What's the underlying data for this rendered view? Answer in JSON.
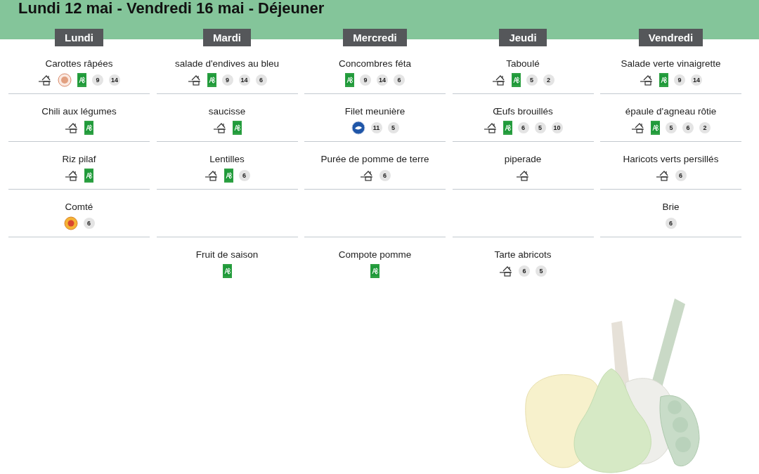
{
  "header": {
    "title": "Lundi 12 mai - Vendredi 16 mai  - Déjeuner"
  },
  "days": [
    {
      "label": "Lundi",
      "courses": [
        {
          "kind": "dish",
          "name": "Carottes râpées",
          "labels": [
            {
              "kind": "homemade"
            },
            {
              "kind": "seal"
            },
            {
              "kind": "organic"
            }
          ],
          "allergens": [
            "9",
            "14"
          ]
        },
        {
          "kind": "dish",
          "name": "Chili aux légumes",
          "labels": [
            {
              "kind": "homemade"
            },
            {
              "kind": "organic"
            }
          ]
        },
        {
          "kind": "dish",
          "name": "Riz pilaf",
          "labels": [
            {
              "kind": "homemade"
            },
            {
              "kind": "organic"
            }
          ]
        },
        {
          "kind": "dish",
          "name": "Comté",
          "labels": [
            {
              "kind": "aop"
            }
          ],
          "allergens": [
            "6"
          ]
        },
        {
          "kind": "empty"
        }
      ]
    },
    {
      "label": "Mardi",
      "courses": [
        {
          "kind": "dish",
          "name": "salade d'endives au bleu",
          "labels": [
            {
              "kind": "homemade"
            },
            {
              "kind": "organic"
            }
          ],
          "allergens": [
            "9",
            "14",
            "6"
          ]
        },
        {
          "kind": "dish",
          "name": "saucisse",
          "labels": [
            {
              "kind": "homemade"
            },
            {
              "kind": "organic"
            }
          ]
        },
        {
          "kind": "dish",
          "name": "Lentilles",
          "labels": [
            {
              "kind": "homemade"
            },
            {
              "kind": "organic"
            }
          ],
          "allergens": [
            "6"
          ]
        },
        {
          "kind": "empty"
        },
        {
          "kind": "dish",
          "name": "Fruit de saison",
          "labels": [
            {
              "kind": "organic"
            }
          ]
        }
      ]
    },
    {
      "label": "Mercredi",
      "courses": [
        {
          "kind": "dish",
          "name": "Concombres féta",
          "labels": [
            {
              "kind": "organic"
            }
          ],
          "allergens": [
            "9",
            "14",
            "6"
          ]
        },
        {
          "kind": "dish",
          "name": "Filet meunière",
          "labels": [
            {
              "kind": "fishery"
            }
          ],
          "allergens": [
            "11",
            "5"
          ]
        },
        {
          "kind": "dish",
          "name": "Purée de pomme de terre",
          "labels": [
            {
              "kind": "homemade"
            }
          ],
          "allergens": [
            "6"
          ]
        },
        {
          "kind": "empty"
        },
        {
          "kind": "dish",
          "name": "Compote pomme",
          "labels": [
            {
              "kind": "organic"
            }
          ]
        }
      ]
    },
    {
      "label": "Jeudi",
      "courses": [
        {
          "kind": "dish",
          "name": "Taboulé",
          "labels": [
            {
              "kind": "homemade"
            },
            {
              "kind": "organic"
            }
          ],
          "allergens": [
            "5",
            "2"
          ]
        },
        {
          "kind": "dish",
          "name": "Œufs brouillés",
          "labels": [
            {
              "kind": "homemade"
            },
            {
              "kind": "organic"
            }
          ],
          "allergens": [
            "6",
            "5",
            "10"
          ]
        },
        {
          "kind": "dish",
          "name": "piperade",
          "labels": [
            {
              "kind": "homemade"
            }
          ]
        },
        {
          "kind": "empty"
        },
        {
          "kind": "dish",
          "name": "Tarte abricots",
          "labels": [
            {
              "kind": "homemade"
            }
          ],
          "allergens": [
            "6",
            "5"
          ]
        }
      ]
    },
    {
      "label": "Vendredi",
      "courses": [
        {
          "kind": "dish",
          "name": "Salade verte vinaigrette",
          "labels": [
            {
              "kind": "homemade"
            },
            {
              "kind": "organic"
            }
          ],
          "allergens": [
            "9",
            "14"
          ]
        },
        {
          "kind": "dish",
          "name": "épaule d'agneau rôtie",
          "labels": [
            {
              "kind": "homemade"
            },
            {
              "kind": "organic"
            }
          ],
          "allergens": [
            "5",
            "6",
            "2"
          ]
        },
        {
          "kind": "dish",
          "name": "Haricots verts persillés",
          "labels": [
            {
              "kind": "homemade"
            }
          ],
          "allergens": [
            "6"
          ]
        },
        {
          "kind": "dish",
          "name": "Brie",
          "allergens": [
            "6"
          ]
        },
        {
          "kind": "empty"
        }
      ]
    }
  ]
}
